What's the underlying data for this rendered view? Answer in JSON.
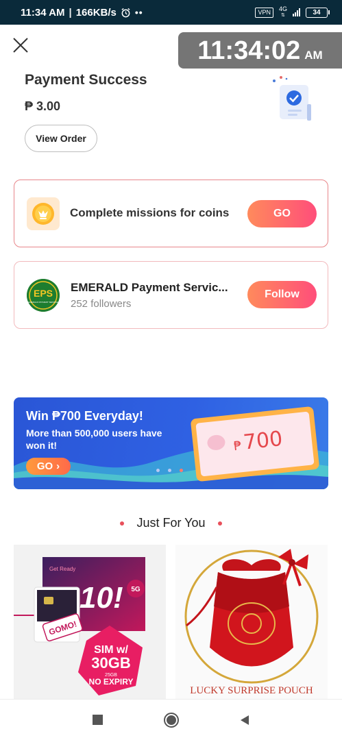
{
  "status_bar": {
    "time": "11:34 AM",
    "speed": "166KB/s",
    "vpn": "VPN",
    "network": "4G",
    "battery": "34"
  },
  "clock_overlay": {
    "time": "11:34:02",
    "ampm": "AM"
  },
  "payment": {
    "title": "Payment Success",
    "amount": "₱ 3.00",
    "view_order_label": "View Order"
  },
  "missions": {
    "text": "Complete missions for coins",
    "button": "GO"
  },
  "store": {
    "name": "EMERALD Payment Servic...",
    "followers": "252 followers",
    "button": "Follow",
    "logo_text": "EPS",
    "logo_subtext": "EMERALD PAYMENT SERVICE"
  },
  "banner": {
    "title": "Win ₱700 Everyday!",
    "subtitle": "More than 500,000 users have won it!",
    "go_label": "GO",
    "ticket_currency": "₱",
    "ticket_amount": "700",
    "slides": 3,
    "active_slide": 2
  },
  "section": {
    "title": "Just For You"
  },
  "products": [
    {
      "top_text": "Get Ready",
      "sim_text": "SIM w/",
      "data_text": "30GB",
      "small_text": "25GB",
      "expiry_text": "NO EXPIRY",
      "brand": "GOMO!",
      "poster_big": "10!",
      "poster_badge": "5G"
    },
    {
      "tag": "LUCKY SURPRISE POUCH"
    }
  ],
  "colors": {
    "accent_gradient_start": "#ff8a5c",
    "accent_gradient_end": "#ff4e7a",
    "banner_blue": "#2f61e3",
    "status_bar": "#0a2a3a"
  },
  "icons": {
    "close": "close-icon",
    "coin": "coin-icon",
    "success": "payment-success-icon",
    "nav_recent": "stop-square-icon",
    "nav_home": "home-circle-icon",
    "nav_back": "back-triangle-icon"
  }
}
